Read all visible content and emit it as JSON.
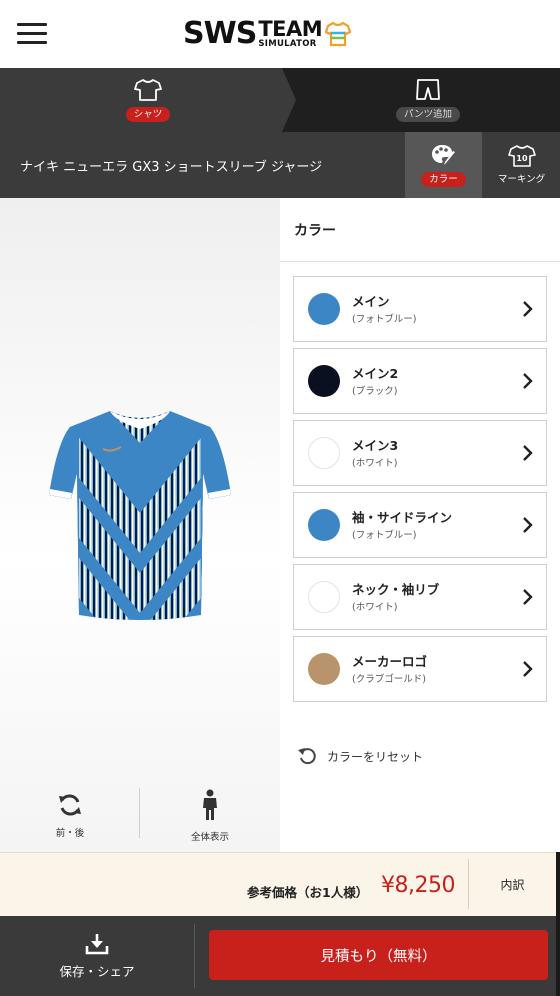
{
  "header": {
    "logo": {
      "sws": "SWS",
      "team": "TEAM",
      "simulator": "SIMULATOR"
    }
  },
  "item_tabs": [
    {
      "label": "シャツ",
      "icon": "shirt-icon",
      "active": true
    },
    {
      "label": "パンツ追加",
      "icon": "pants-icon",
      "active": false
    }
  ],
  "product": {
    "name": "ナイキ ニューエラ GX3 ショートスリーブ ジャージ",
    "modes": [
      {
        "label": "カラー",
        "icon": "palette-icon",
        "active": true
      },
      {
        "label": "マーキング",
        "icon": "marking-shirt-icon",
        "active": false
      }
    ]
  },
  "preview": {
    "front_back_label": "前・後",
    "full_view_label": "全体表示"
  },
  "color_panel": {
    "title": "カラー",
    "rows": [
      {
        "name": "メイン",
        "color_name": "(フォトブルー)",
        "hex": "#3d86c6"
      },
      {
        "name": "メイン2",
        "color_name": "(ブラック)",
        "hex": "#0b1020"
      },
      {
        "name": "メイン3",
        "color_name": "(ホワイト)",
        "hex": "#ffffff"
      },
      {
        "name": "袖・サイドライン",
        "color_name": "(フォトブルー)",
        "hex": "#3d86c6"
      },
      {
        "name": "ネック・袖リブ",
        "color_name": "(ホワイト)",
        "hex": "#ffffff"
      },
      {
        "name": "メーカーロゴ",
        "color_name": "(クラブゴールド)",
        "hex": "#b8936b"
      }
    ],
    "reset_label": "カラーをリセット"
  },
  "price": {
    "label": "参考価格（お1人様）",
    "value": "¥8,250",
    "breakdown_label": "内訳"
  },
  "footer": {
    "save_label": "保存・シェア",
    "quote_label": "見積もり（無料）"
  },
  "colors": {
    "accent": "#c8211c",
    "dark": "#1f1f1f",
    "product_bar": "#3b3b3b",
    "price_bg": "#fbf4e8"
  }
}
